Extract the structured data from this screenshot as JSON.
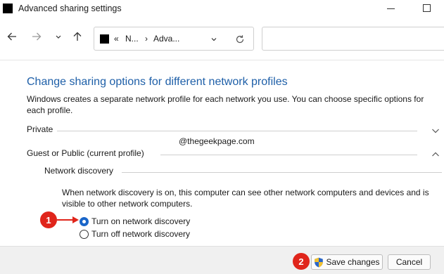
{
  "window": {
    "title": "Advanced sharing settings"
  },
  "address": {
    "overflow": "«",
    "crumb1": "N...",
    "crumb2": "Adva..."
  },
  "content": {
    "heading": "Change sharing options for different network profiles",
    "description": "Windows creates a separate network profile for each network you use. You can choose specific options for each profile.",
    "private_label": "Private",
    "guest_label": "Guest or Public (current profile)",
    "network_discovery_label": "Network discovery",
    "nd_description": "When network discovery is on, this computer can see other network computers and devices and is visible to other network computers.",
    "radio_on_label": "Turn on network discovery",
    "radio_off_label": "Turn off network discovery",
    "watermark": "@thegeekpage.com"
  },
  "annotations": {
    "badge1": "1",
    "badge2": "2",
    "color": "#e0251b"
  },
  "footer": {
    "save_label": "Save changes",
    "cancel_label": "Cancel"
  },
  "icons": {
    "back": "arrow-left-icon",
    "forward": "arrow-right-icon",
    "recent": "chevron-down-icon",
    "up": "arrow-up-icon",
    "refresh": "refresh-icon",
    "shield": "uac-shield-icon"
  }
}
